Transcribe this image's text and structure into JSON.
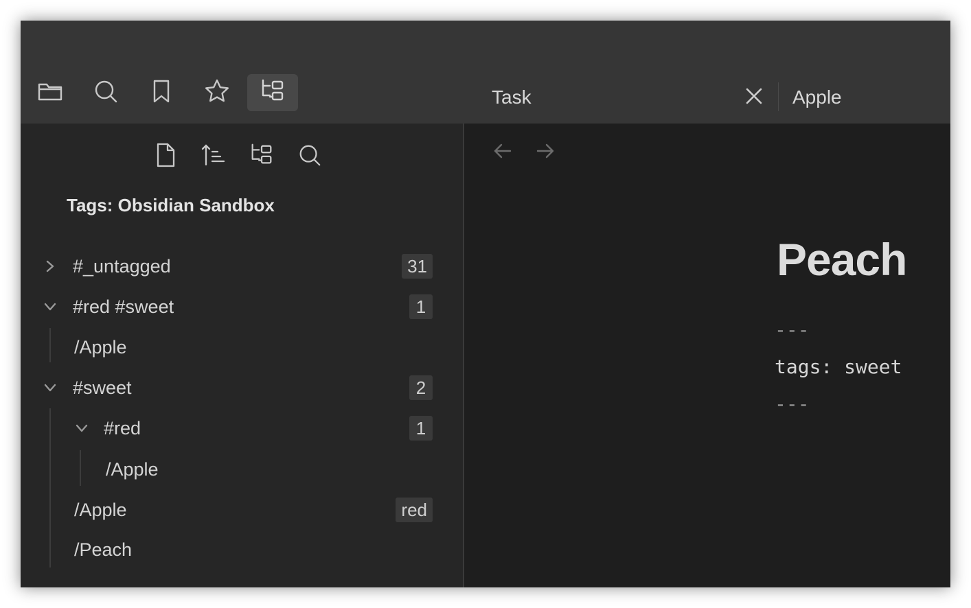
{
  "ribbon": {
    "icons": [
      "folder-icon",
      "search-icon",
      "bookmark-icon",
      "star-icon",
      "tag-tree-icon"
    ],
    "active": "tag-tree-icon"
  },
  "tabs": [
    {
      "title": "Task",
      "active": true
    },
    {
      "title": "Apple",
      "active": false
    }
  ],
  "sidebar": {
    "nav_icons": [
      "new-note-icon",
      "sort-icon",
      "tag-tree-icon",
      "search-icon"
    ],
    "title": "Tags: Obsidian Sandbox",
    "items": [
      {
        "label": "#_untagged",
        "count": "31",
        "expanded": false
      },
      {
        "label": "#red #sweet",
        "count": "1",
        "expanded": true
      },
      {
        "label": "/Apple"
      },
      {
        "label": "#sweet",
        "count": "2",
        "expanded": true
      },
      {
        "label": "#red",
        "count": "1",
        "expanded": true
      },
      {
        "label": "/Apple"
      },
      {
        "label": "/Apple",
        "badge": "red"
      },
      {
        "label": "/Peach"
      }
    ]
  },
  "note": {
    "title": "Peach",
    "frontmatter": [
      "---",
      "tags: sweet",
      "---"
    ]
  },
  "colors": {
    "titlebar": "#363636",
    "sidebar": "#262626",
    "editor": "#1e1e1e",
    "text": "#d4d4d4"
  }
}
